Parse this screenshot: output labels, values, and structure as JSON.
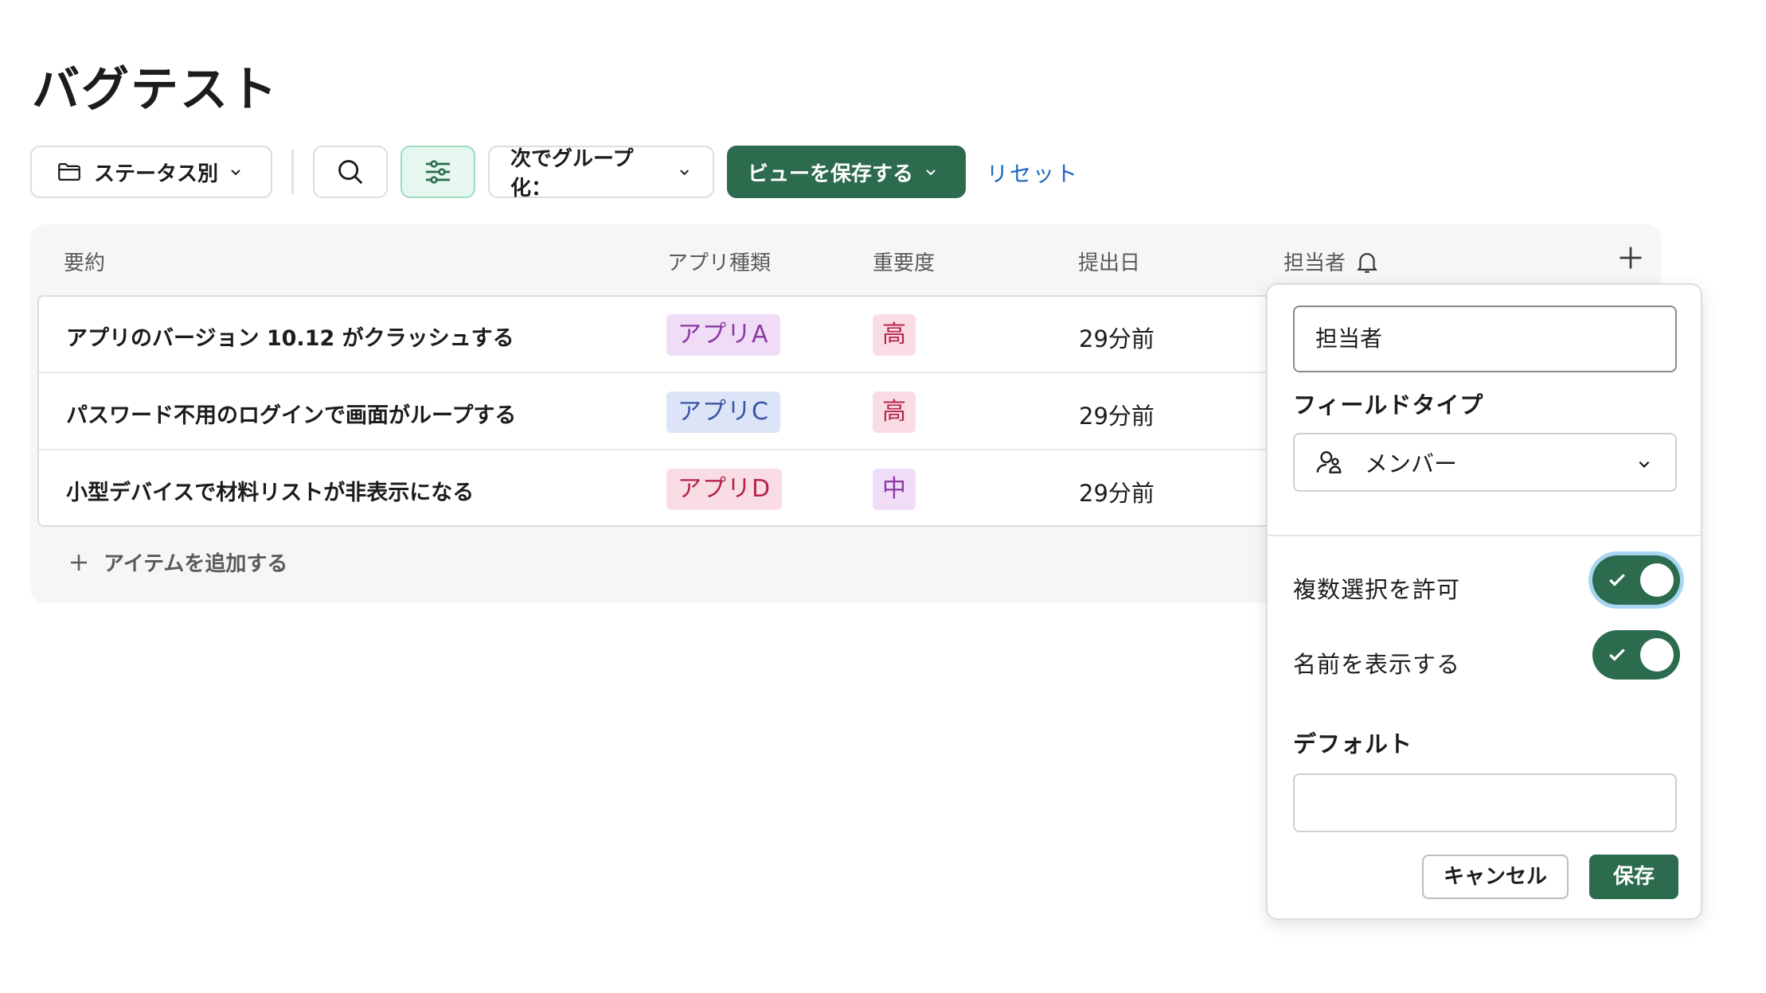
{
  "page": {
    "title": "バグテスト"
  },
  "toolbar": {
    "status_label": "ステータス別",
    "group_label": "次でグループ化：",
    "save_view_label": "ビューを保存する",
    "reset_label": "リセット"
  },
  "table": {
    "columns": [
      "要約",
      "アプリ種類",
      "重要度",
      "提出日",
      "担当者"
    ],
    "rows": [
      {
        "summary": "アプリのバージョン 10.12 がクラッシュする",
        "app": "アプリA",
        "priority": "高",
        "date": "29分前"
      },
      {
        "summary": "パスワード不用のログインで画面がループする",
        "app": "アプリC",
        "priority": "高",
        "date": "29分前"
      },
      {
        "summary": "小型デバイスで材料リストが非表示になる",
        "app": "アプリD",
        "priority": "中",
        "date": "29分前"
      }
    ],
    "add_item_label": "アイテムを追加する"
  },
  "tag_colors": {
    "app_a": {
      "bg": "#f1dcf7",
      "fg": "#8a3aa3"
    },
    "app_c": {
      "bg": "#dde4f8",
      "fg": "#3b54a8"
    },
    "app_d": {
      "bg": "#fadde4",
      "fg": "#b5244d"
    },
    "prio_high": {
      "bg": "#fadde4",
      "fg": "#b5244d"
    },
    "prio_mid": {
      "bg": "#f1dcf7",
      "fg": "#8a3aa3"
    }
  },
  "panel": {
    "field_name": "担当者",
    "field_type_label": "フィールドタイプ",
    "field_type_value": "メンバー",
    "allow_multi_label": "複数選択を許可",
    "allow_multi_on": true,
    "show_names_label": "名前を表示する",
    "show_names_on": true,
    "default_label": "デフォルト",
    "default_value": "",
    "cancel_label": "キャンセル",
    "save_label": "保存"
  },
  "colors": {
    "accent": "#2c6b4e",
    "link": "#1d64c0"
  }
}
